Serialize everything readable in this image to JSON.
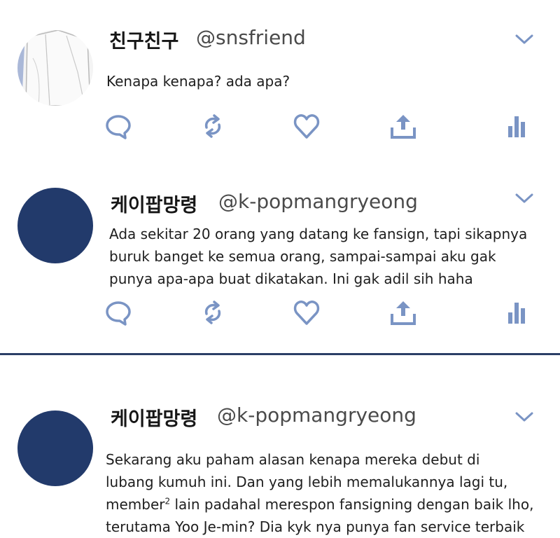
{
  "tweets": [
    {
      "display_name": "친구친구",
      "handle": "@snsfriend",
      "text_lines": [
        "Kenapa kenapa? ada apa?"
      ]
    },
    {
      "display_name": "케이팝망령",
      "handle": "@k-popmangryeong",
      "text_lines": [
        "Ada sekitar 20 orang yang datang ke fansign, tapi sikapnya",
        "buruk banget ke semua orang, sampai-sampai aku gak",
        "punya apa-apa buat dikatakan. Ini gak adil sih haha"
      ]
    },
    {
      "display_name": "케이팝망령",
      "handle": "@k-popmangryeong",
      "text_lines": [
        "Sekarang aku paham alasan kenapa mereka debut di",
        "lubang kumuh ini. Dan yang lebih memalukannya lagi tu,",
        "member",
        "2",
        " lain padahal merespon fansigning dengan baik lho,",
        "terutama Yoo Je-min? Dia kyk nya punya fan service terbaik"
      ]
    }
  ],
  "actions": [
    "reply-icon",
    "retweet-icon",
    "like-icon",
    "share-icon",
    "analytics-icon"
  ],
  "colors": {
    "icon": "#7a94c4",
    "avatar": "#223a6b",
    "divider": "#2a3e66"
  }
}
